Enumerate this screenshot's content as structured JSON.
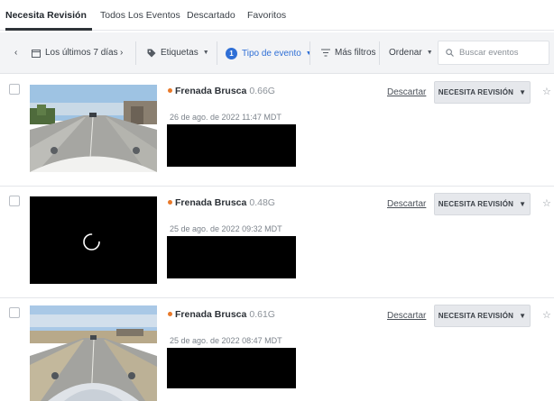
{
  "tabs": [
    {
      "label": "Necesita Revisión"
    },
    {
      "label": "Todos Los Eventos"
    },
    {
      "label": "Descartado"
    },
    {
      "label": "Favoritos"
    }
  ],
  "filters": {
    "date_range": "Los últimos 7 días",
    "tags": "Etiquetas",
    "event_type_count": "1",
    "event_type": "Tipo de evento",
    "more_filters": "Más filtros",
    "sort": "Ordenar",
    "search_placeholder": "Buscar eventos"
  },
  "events": [
    {
      "type": "Frenada Brusca",
      "force": "0.66G",
      "timestamp": "26 de ago. de 2022 11:47 MDT",
      "discard": "Descartar",
      "status": "NECESITA REVISIÓN",
      "thumbnail": "road-camera-view"
    },
    {
      "type": "Frenada Brusca",
      "force": "0.48G",
      "timestamp": "25 de ago. de 2022 09:32 MDT",
      "discard": "Descartar",
      "status": "NECESITA REVISIÓN",
      "thumbnail": "loading"
    },
    {
      "type": "Frenada Brusca",
      "force": "0.61G",
      "timestamp": "25 de ago. de 2022 08:47 MDT",
      "discard": "Descartar",
      "status": "NECESITA REVISIÓN",
      "thumbnail": "road-camera-view"
    }
  ],
  "colors": {
    "accent": "#2f6fd6",
    "event_dot": "#e8792a",
    "status_button_bg": "#e6e8ec"
  }
}
